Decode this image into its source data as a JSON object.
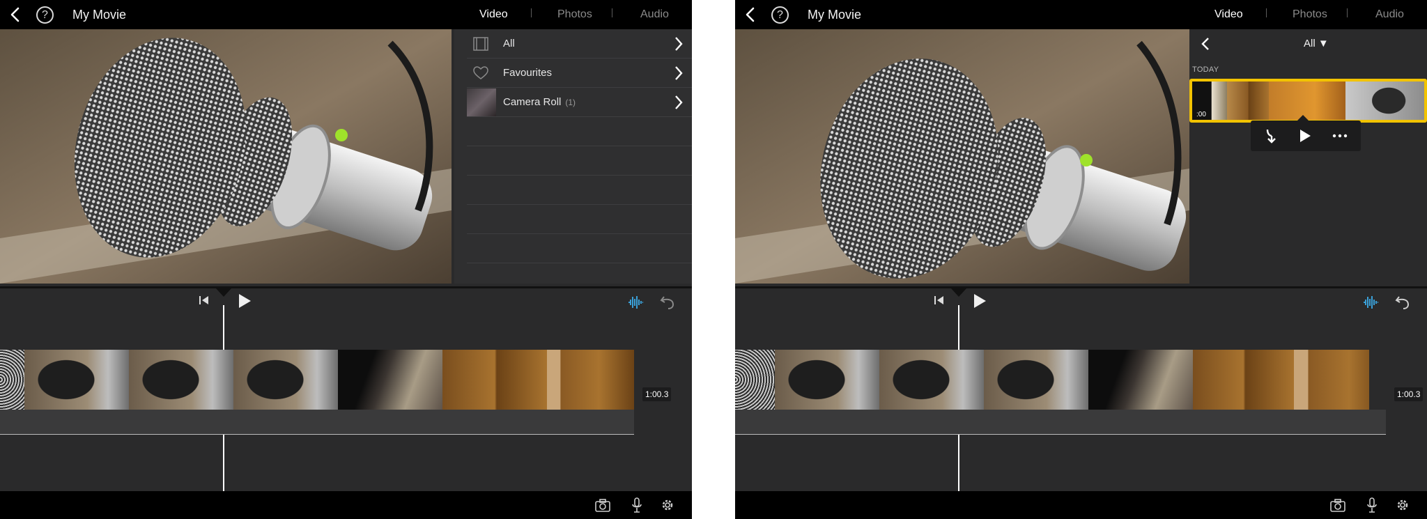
{
  "panels": [
    {
      "header": {
        "title": "My Movie",
        "help_glyph": "?"
      },
      "tabs": [
        {
          "label": "Video",
          "active": true
        },
        {
          "label": "Photos",
          "active": false
        },
        {
          "label": "Audio",
          "active": false
        }
      ],
      "browser": {
        "mode": "albums",
        "items": [
          {
            "label": "All",
            "count": "",
            "icon": "film-icon"
          },
          {
            "label": "Favourites",
            "count": "",
            "icon": "heart-icon"
          },
          {
            "label": "Camera Roll",
            "count": "(1)",
            "icon": "camera-roll-thumbnail"
          }
        ]
      },
      "timeline": {
        "duration": "1:00.3"
      }
    },
    {
      "header": {
        "title": "My Movie",
        "help_glyph": "?"
      },
      "tabs": [
        {
          "label": "Video",
          "active": true
        },
        {
          "label": "Photos",
          "active": false
        },
        {
          "label": "Audio",
          "active": false
        }
      ],
      "browser": {
        "mode": "clips",
        "filter_label": "All",
        "section_label": "TODAY",
        "selected_clip": {
          "duration": ":00"
        },
        "actions": [
          {
            "icon": "add-to-project-icon"
          },
          {
            "icon": "play-icon"
          },
          {
            "icon": "more-icon"
          }
        ]
      },
      "timeline": {
        "duration": "1:00.3"
      }
    }
  ],
  "colors": {
    "background": "#2a2a2b",
    "bar": "#000000",
    "selection": "#f2c300",
    "accent": "#3aa0d8",
    "indicator": "#9fe22a"
  }
}
